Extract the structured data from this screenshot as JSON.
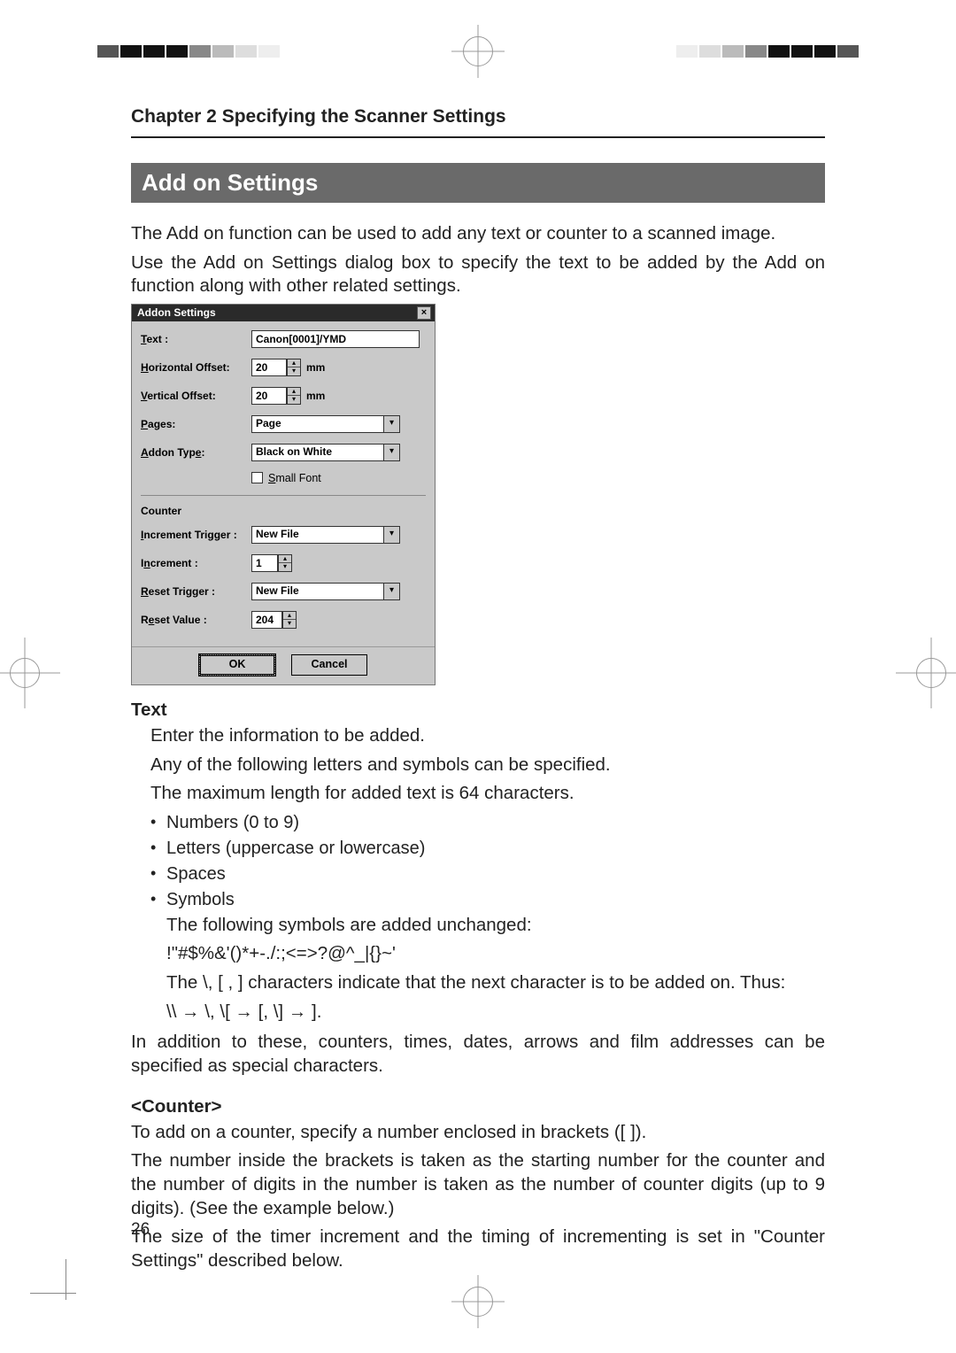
{
  "chapter_title": "Chapter 2 Specifying the Scanner Settings",
  "section_title": "Add on Settings",
  "intro_p1": "The Add on function can be used to add any text or counter to a scanned image.",
  "intro_p2": "Use the Add on Settings dialog box to specify the text to be added by the Add on function along with other related settings.",
  "dialog": {
    "title": "Addon Settings",
    "close_label": "×",
    "text_label": "Text :",
    "text_value": "Canon[0001]/YMD",
    "h_offset_label": "Horizontal Offset:",
    "h_offset_value": "20",
    "v_offset_label": "Vertical Offset:",
    "v_offset_value": "20",
    "unit_mm": "mm",
    "pages_label": "Pages:",
    "pages_value": "Page",
    "addon_type_label": "Addon Type:",
    "addon_type_value": "Black on White",
    "smallfont_label": "Small Font",
    "counter_head": "Counter",
    "inc_trigger_label": "Increment Trigger :",
    "inc_trigger_value": "New File",
    "increment_label": "Increment :",
    "increment_value": "1",
    "reset_trigger_label": "Reset Trigger :",
    "reset_trigger_value": "New File",
    "reset_value_label": "Reset Value :",
    "reset_value_value": "204",
    "ok": "OK",
    "cancel": "Cancel"
  },
  "text_heading": "Text",
  "text_p1": "Enter the information to be added.",
  "text_p2": "Any of the following letters and symbols can be specified.",
  "text_p3": "The maximum length for added text is 64 characters.",
  "bullets": {
    "b1": "Numbers (0 to 9)",
    "b2": "Letters (uppercase or lowercase)",
    "b3": "Spaces",
    "b4": "Symbols",
    "sy1": "The following symbols are added unchanged:",
    "sy2": "!\"#$%&'()*+-./:;<=>?@^_|{}~'",
    "sy3": "The \\, [ ,  ] characters indicate that the next character is to be added on. Thus:",
    "sy4": "\\\\ → \\, \\[ → [,  \\] → ]."
  },
  "after_bullets": "In addition to these, counters, times, dates, arrows and film addresses can be specified as special characters.",
  "counter_heading": "<Counter>",
  "counter_p1": "To add on a counter, specify a number enclosed in brackets ([  ]).",
  "counter_p2": "The number inside the brackets is taken as the starting number for the counter and the number of digits in the number is taken as the number of counter digits (up to 9 digits). (See the example below.)",
  "counter_p3": "The size of the timer increment and the timing of incrementing is set in \"Counter Settings\" described below.",
  "page_number": "26"
}
